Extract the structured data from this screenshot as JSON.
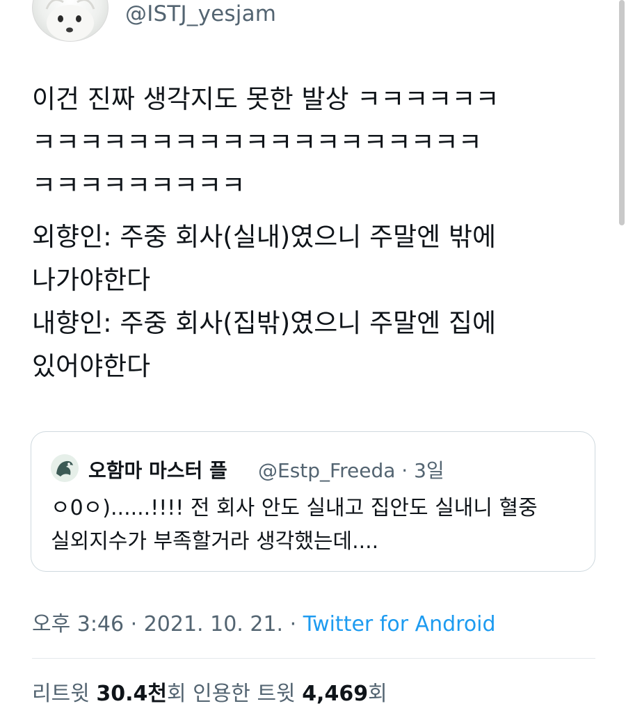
{
  "header": {
    "handle": "@ISTJ_yesjam"
  },
  "tweet": {
    "lines": [
      "이건 진짜 생각지도 못한 발상 ㅋㅋㅋㅋㅋㅋ",
      "ㅋㅋㅋㅋㅋㅋㅋㅋㅋㅋㅋㅋㅋㅋㅋㅋㅋㅋㅋ",
      "ㅋㅋㅋㅋㅋㅋㅋㅋㅋ",
      "외향인: 주중 회사(실내)였으니 주말엔 밖에",
      "나가야한다",
      "내향인: 주중 회사(집밖)였으니 주말엔 집에",
      "있어야한다"
    ]
  },
  "quote": {
    "name": "오함마 마스터 플",
    "handle": "@Estp_Freeda · 3일",
    "lines": [
      "ㅇ0ㅇ)......!!!! 전 회사 안도 실내고 집안도 실내니 혈중",
      "실외지수가 부족할거라 생각했는데...."
    ]
  },
  "meta": {
    "time": "오후 3:46 · 2021. 10. 21. · ",
    "source": "Twitter for Android"
  },
  "stats": {
    "retweet_label": "리트윗 ",
    "retweet_count": "30.4천",
    "retweet_suffix": "회  인용한 트윗 ",
    "quote_count": "4,469",
    "quote_suffix": "회"
  },
  "colors": {
    "text": "#0f1419",
    "secondary": "#536471",
    "link": "#1d9bf0",
    "border": "#cfd9de"
  },
  "icons": {
    "avatar": "dog-avatar",
    "quote_avatar": "dragon-avatar"
  }
}
